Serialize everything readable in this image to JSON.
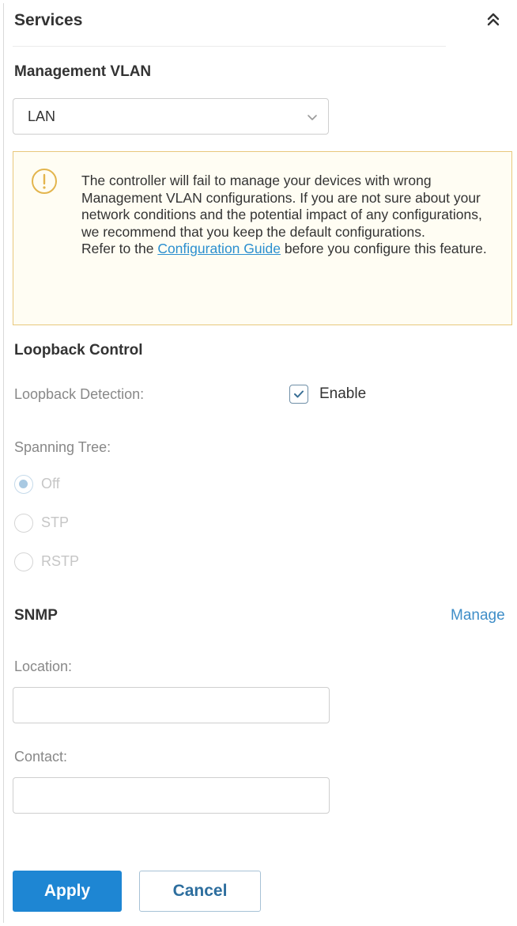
{
  "section": {
    "title": "Services",
    "collapse_icon": "double-chevron-up-icon"
  },
  "management_vlan": {
    "title": "Management VLAN",
    "selected": "LAN",
    "icon": "chevron-down-icon"
  },
  "warning": {
    "icon": "warning-icon",
    "line1": "The controller will fail to manage your devices with wrong Management VLAN configurations. If you are not sure about your network conditions and the potential impact of any configurations, we recommend that you keep the default configurations.",
    "refer_prefix": "Refer to the ",
    "link_text": "Configuration Guide",
    "refer_suffix": " before you configure this feature.",
    "colors": {
      "border": "#e8c87c",
      "icon": "#e3b54d",
      "link": "#2b8fcf"
    }
  },
  "loopback": {
    "title": "Loopback Control",
    "detection_label": "Loopback Detection:",
    "enable_label": "Enable",
    "enable_checked": true,
    "spanning_tree_label": "Spanning Tree:",
    "spanning_tree_options": [
      {
        "label": "Off",
        "checked": true
      },
      {
        "label": "STP",
        "checked": false
      },
      {
        "label": "RSTP",
        "checked": false
      }
    ]
  },
  "snmp": {
    "title": "SNMP",
    "manage_link": "Manage",
    "location_label": "Location:",
    "location_value": "",
    "contact_label": "Contact:",
    "contact_value": ""
  },
  "actions": {
    "apply_label": "Apply",
    "cancel_label": "Cancel",
    "primary_color": "#1e86d3"
  }
}
